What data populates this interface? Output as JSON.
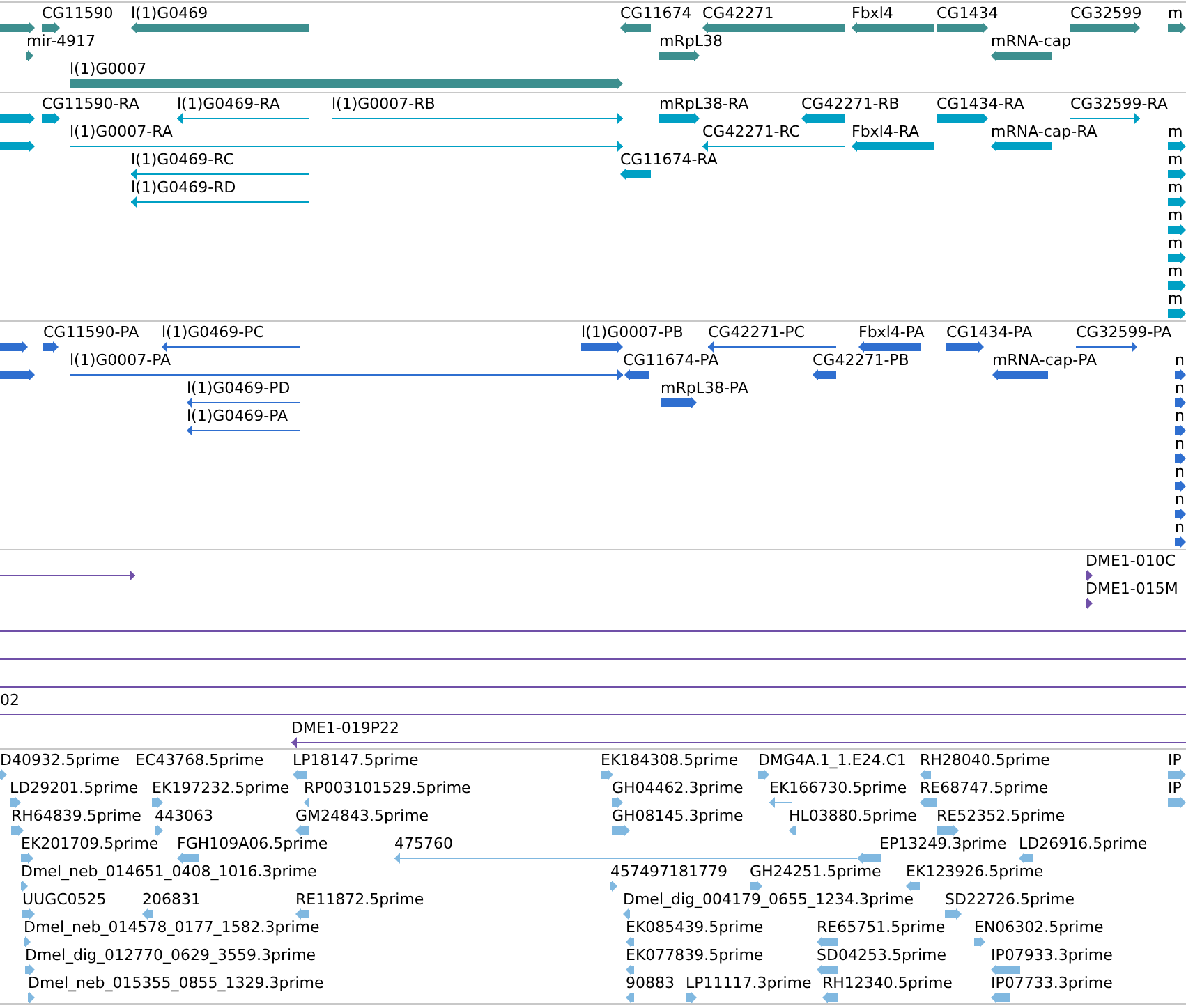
{
  "tracks": [
    {
      "color": "#3d8f8f",
      "rows": [
        {
          "features": [
            {
              "kind": "block",
              "reverse": false
            },
            {
              "label": "CG11590",
              "kind": "block",
              "reverse": false
            },
            {
              "label": "l(1)G0469",
              "kind": "block",
              "reverse": true
            },
            {
              "label": "CG11674",
              "kind": "block",
              "reverse": true
            },
            {
              "label": "CG42271",
              "kind": "block",
              "reverse": true
            },
            {
              "label": "Fbxl4",
              "kind": "block",
              "reverse": true
            },
            {
              "label": "CG1434",
              "kind": "block",
              "reverse": false
            },
            {
              "label": "CG32599",
              "kind": "block",
              "reverse": false
            },
            {
              "label": "m",
              "kind": "block",
              "reverse": false
            }
          ]
        },
        {
          "features": [
            {
              "label": "mir-4917",
              "kind": "block",
              "reverse": false
            },
            {
              "label": "mRpL38",
              "kind": "block",
              "reverse": false
            },
            {
              "label": "mRNA-cap",
              "kind": "block",
              "reverse": true
            }
          ]
        },
        {
          "features": [
            {
              "label": "l(1)G0007",
              "kind": "block",
              "reverse": false
            }
          ]
        }
      ]
    },
    {
      "color": "#00a0c4",
      "rows": [
        {
          "features": [
            {
              "kind": "block",
              "reverse": false
            },
            {
              "label": "CG11590-RA",
              "kind": "block",
              "reverse": false
            },
            {
              "label": "l(1)G0469-RA",
              "kind": "line",
              "reverse": true
            },
            {
              "label": "l(1)G0007-RB",
              "kind": "line",
              "reverse": false
            },
            {
              "label": "mRpL38-RA",
              "kind": "block",
              "reverse": false
            },
            {
              "label": "CG42271-RB",
              "kind": "block",
              "reverse": true
            },
            {
              "label": "CG1434-RA",
              "kind": "block",
              "reverse": false
            },
            {
              "label": "CG32599-RA",
              "kind": "line",
              "reverse": false
            }
          ]
        },
        {
          "features": [
            {
              "kind": "block",
              "reverse": false
            },
            {
              "label": "l(1)G0007-RA",
              "kind": "line",
              "reverse": false
            },
            {
              "label": "CG42271-RC",
              "kind": "line",
              "reverse": true
            },
            {
              "label": "Fbxl4-RA",
              "kind": "block",
              "reverse": true
            },
            {
              "label": "mRNA-cap-RA",
              "kind": "block",
              "reverse": true
            },
            {
              "label": "m",
              "kind": "block",
              "reverse": false
            }
          ]
        },
        {
          "features": [
            {
              "label": "l(1)G0469-RC",
              "kind": "line",
              "reverse": true
            },
            {
              "label": "CG11674-RA",
              "kind": "block",
              "reverse": true
            },
            {
              "label": "m",
              "kind": "block",
              "reverse": false
            }
          ]
        },
        {
          "features": [
            {
              "label": "l(1)G0469-RD",
              "kind": "line",
              "reverse": true
            },
            {
              "label": "m",
              "kind": "block",
              "reverse": false
            }
          ]
        },
        {
          "features": [
            {
              "label": "m",
              "kind": "block",
              "reverse": false
            }
          ]
        },
        {
          "features": [
            {
              "label": "m",
              "kind": "block",
              "reverse": false
            }
          ]
        },
        {
          "features": [
            {
              "label": "m",
              "kind": "block",
              "reverse": false
            }
          ]
        },
        {
          "features": [
            {
              "label": "m",
              "kind": "block",
              "reverse": false
            }
          ]
        }
      ]
    },
    {
      "color": "#2f6fd0",
      "rows": [
        {
          "features": [
            {
              "kind": "block",
              "reverse": false
            },
            {
              "label": "CG11590-PA",
              "kind": "block",
              "reverse": false
            },
            {
              "label": "l(1)G0469-PC",
              "kind": "line",
              "reverse": true
            },
            {
              "label": "l(1)G0007-PB",
              "kind": "block",
              "reverse": false
            },
            {
              "label": "CG42271-PC",
              "kind": "line",
              "reverse": true
            },
            {
              "label": "Fbxl4-PA",
              "kind": "block",
              "reverse": true
            },
            {
              "label": "CG1434-PA",
              "kind": "block",
              "reverse": false
            },
            {
              "label": "CG32599-PA",
              "kind": "line",
              "reverse": false
            }
          ]
        },
        {
          "features": [
            {
              "kind": "block",
              "reverse": false
            },
            {
              "label": "l(1)G0007-PA",
              "kind": "line",
              "reverse": false
            },
            {
              "label": "CG11674-PA",
              "kind": "block",
              "reverse": true
            },
            {
              "label": "CG42271-PB",
              "kind": "block",
              "reverse": true
            },
            {
              "label": "mRNA-cap-PA",
              "kind": "block",
              "reverse": true
            },
            {
              "label": "n",
              "kind": "block",
              "reverse": false
            }
          ]
        },
        {
          "features": [
            {
              "label": "l(1)G0469-PD",
              "kind": "line",
              "reverse": true
            },
            {
              "label": "mRpL38-PA",
              "kind": "block",
              "reverse": false
            },
            {
              "label": "n",
              "kind": "block",
              "reverse": false
            }
          ]
        },
        {
          "features": [
            {
              "label": "l(1)G0469-PA",
              "kind": "line",
              "reverse": true
            },
            {
              "label": "n",
              "kind": "block",
              "reverse": false
            }
          ]
        },
        {
          "features": [
            {
              "label": "n",
              "kind": "block",
              "reverse": false
            }
          ]
        },
        {
          "features": [
            {
              "label": "n",
              "kind": "block",
              "reverse": false
            }
          ]
        },
        {
          "features": [
            {
              "label": "n",
              "kind": "block",
              "reverse": false
            }
          ]
        },
        {
          "features": [
            {
              "label": "n",
              "kind": "block",
              "reverse": false
            }
          ]
        }
      ]
    },
    {
      "color": "#7050a8",
      "rows": [
        {
          "features": [
            {
              "kind": "line",
              "reverse": false
            },
            {
              "label": "DME1-010C",
              "kind": "block",
              "reverse": false
            }
          ]
        },
        {
          "features": [
            {
              "label": "DME1-015M",
              "kind": "block",
              "reverse": false
            }
          ]
        },
        {
          "features": [
            {
              "kind": "line"
            }
          ]
        },
        {
          "features": [
            {
              "kind": "line"
            }
          ]
        },
        {
          "features": [
            {
              "kind": "line"
            }
          ]
        },
        {
          "features": [
            {
              "label": "02",
              "kind": "line"
            }
          ]
        },
        {
          "features": [
            {
              "label": "DME1-019P22",
              "kind": "line",
              "reverse": true
            }
          ]
        }
      ]
    },
    {
      "color": "#80b8e0",
      "rows": [
        {
          "features": [
            {
              "label": "D40932.5prime",
              "kind": "block",
              "reverse": false
            },
            {
              "label": "EC43768.5prime"
            },
            {
              "label": "LP18147.5prime",
              "kind": "block",
              "reverse": true
            },
            {
              "label": "EK184308.5prime",
              "kind": "block",
              "reverse": false
            },
            {
              "label": "DMG4A.1_1.E24.C1",
              "kind": "block",
              "reverse": false
            },
            {
              "label": "RH28040.5prime",
              "kind": "block",
              "reverse": true
            },
            {
              "label": "IP",
              "kind": "block",
              "reverse": false
            }
          ]
        },
        {
          "features": [
            {
              "label": "LD29201.5prime",
              "kind": "block",
              "reverse": false
            },
            {
              "label": "EK197232.5prime",
              "kind": "block",
              "reverse": false
            },
            {
              "label": "RP003101529.5prime",
              "kind": "block",
              "reverse": true
            },
            {
              "label": "GH04462.3prime",
              "kind": "block",
              "reverse": false
            },
            {
              "label": "EK166730.5prime",
              "kind": "line",
              "reverse": true
            },
            {
              "label": "RE68747.5prime",
              "kind": "block",
              "reverse": true
            },
            {
              "label": "IP",
              "kind": "block",
              "reverse": false
            }
          ]
        },
        {
          "features": [
            {
              "label": "RH64839.5prime",
              "kind": "block",
              "reverse": false
            },
            {
              "label": "443063",
              "kind": "block",
              "reverse": false
            },
            {
              "label": "GM24843.5prime",
              "kind": "block",
              "reverse": true
            },
            {
              "label": "GH08145.3prime",
              "kind": "block",
              "reverse": false
            },
            {
              "label": "HL03880.5prime",
              "kind": "block",
              "reverse": true
            },
            {
              "label": "RE52352.5prime",
              "kind": "block",
              "reverse": false
            }
          ]
        },
        {
          "features": [
            {
              "label": "EK201709.5prime",
              "kind": "block",
              "reverse": false
            },
            {
              "label": "FGH109A06.5prime",
              "kind": "block",
              "reverse": true
            },
            {
              "label": "475760",
              "kind": "line",
              "reverse": true
            },
            {
              "label": "EP13249.3prime",
              "kind": "block",
              "reverse": true
            },
            {
              "label": "LD26916.5prime",
              "kind": "block",
              "reverse": true
            }
          ]
        },
        {
          "features": [
            {
              "label": "Dmel_neb_014651_0408_1016.3prime",
              "kind": "block",
              "reverse": false
            },
            {
              "label": "457497181779",
              "kind": "block",
              "reverse": false
            },
            {
              "label": "GH24251.5prime",
              "kind": "block",
              "reverse": false
            },
            {
              "label": "EK123926.5prime",
              "kind": "block",
              "reverse": true
            }
          ]
        },
        {
          "features": [
            {
              "label": "UUGC0525",
              "kind": "block",
              "reverse": false
            },
            {
              "label": "206831",
              "kind": "block",
              "reverse": true
            },
            {
              "label": "RE11872.5prime",
              "kind": "block",
              "reverse": true
            },
            {
              "label": "Dmel_dig_004179_0655_1234.3prime",
              "kind": "block",
              "reverse": true
            },
            {
              "label": "SD22726.5prime",
              "kind": "block",
              "reverse": false
            }
          ]
        },
        {
          "features": [
            {
              "label": "Dmel_neb_014578_0177_1582.3prime",
              "kind": "block",
              "reverse": false
            },
            {
              "label": "EK085439.5prime",
              "kind": "block",
              "reverse": true
            },
            {
              "label": "RE65751.5prime",
              "kind": "block",
              "reverse": true
            },
            {
              "label": "EN06302.5prime",
              "kind": "block",
              "reverse": false
            }
          ]
        },
        {
          "features": [
            {
              "label": "Dmel_dig_012770_0629_3559.3prime",
              "kind": "block",
              "reverse": false
            },
            {
              "label": "EK077839.5prime",
              "kind": "block",
              "reverse": true
            },
            {
              "label": "SD04253.5prime",
              "kind": "block",
              "reverse": true
            },
            {
              "label": "IP07933.3prime",
              "kind": "block",
              "reverse": true
            }
          ]
        },
        {
          "features": [
            {
              "label": "Dmel_neb_015355_0855_1329.3prime",
              "kind": "block",
              "reverse": false
            },
            {
              "label": "90883",
              "kind": "block",
              "reverse": true
            },
            {
              "label": "LP11117.3prime",
              "kind": "block",
              "reverse": false
            },
            {
              "label": "RH12340.5prime",
              "kind": "block",
              "reverse": true
            },
            {
              "label": "IP07733.3prime",
              "kind": "block",
              "reverse": true
            }
          ]
        }
      ]
    }
  ]
}
